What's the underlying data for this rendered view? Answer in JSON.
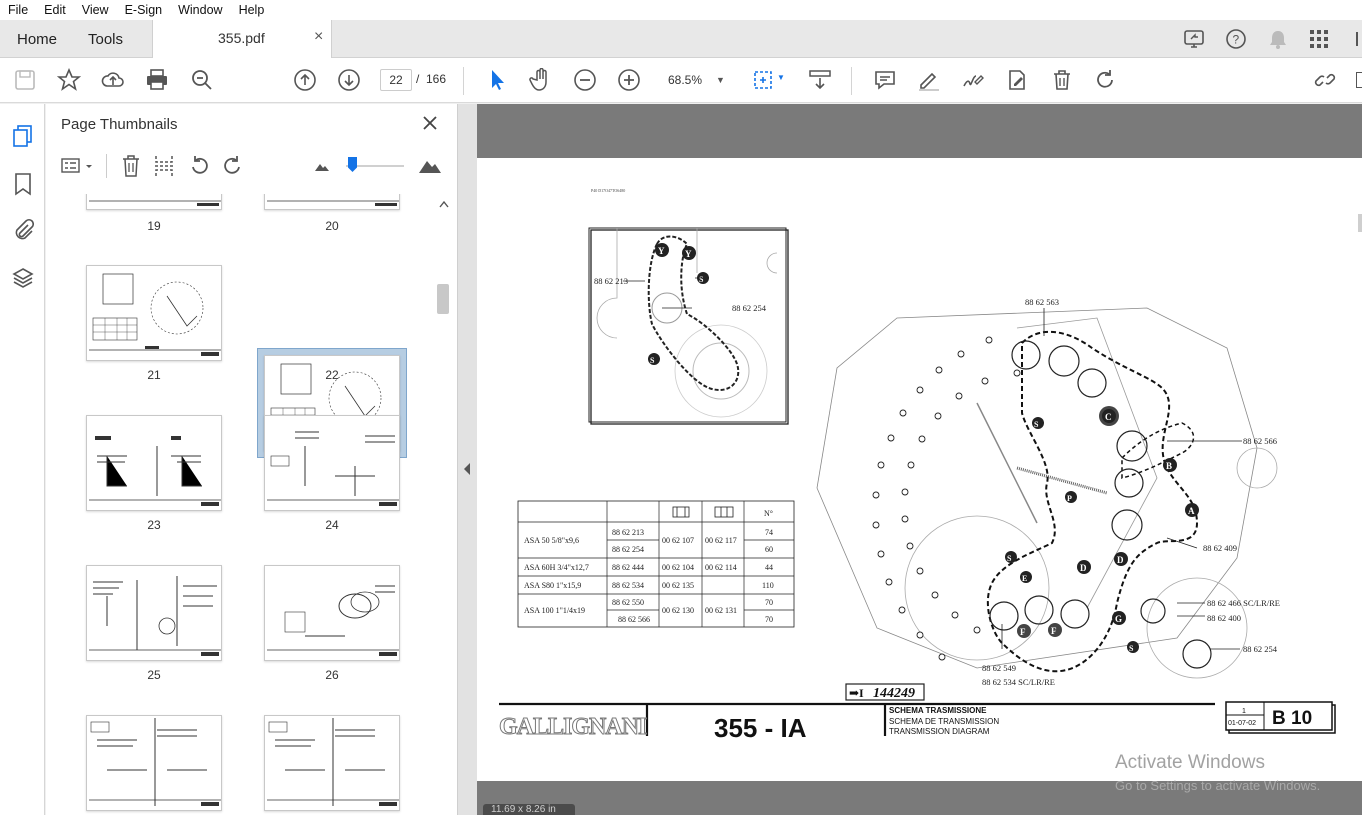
{
  "menu": [
    "File",
    "Edit",
    "View",
    "E-Sign",
    "Window",
    "Help"
  ],
  "tabs": {
    "home": "Home",
    "tools": "Tools",
    "document": "355.pdf",
    "close": "×"
  },
  "toolbar": {
    "page_current": "22",
    "page_separator": "/",
    "page_total": "166",
    "zoom": "68.5%"
  },
  "panel": {
    "title": "Page Thumbnails",
    "selected_page": 22
  },
  "thumbnails": [
    {
      "label": "19"
    },
    {
      "label": "20"
    },
    {
      "label": "21"
    },
    {
      "label": "22"
    },
    {
      "label": "23"
    },
    {
      "label": "24"
    },
    {
      "label": "25"
    },
    {
      "label": "26"
    }
  ],
  "drawing": {
    "brand": "GALLIGNANI",
    "model": "355 - IA",
    "title_lines": [
      "SCHEMA TRASMISSIONE",
      "SCHEMA DE TRANSMISSION",
      "TRANSMISSION DIAGRAM"
    ],
    "sheet_number": "1",
    "sheet_date": "01-07-02",
    "code": "B 10",
    "serial_prefix": "➡I",
    "serial": "144249",
    "small_header": "P40    D17O47TO6480",
    "callouts": {
      "c1": "88 62 213",
      "c2": "88 62 254",
      "c3": "88 62 563",
      "c4": "88 62 566",
      "c5": "88 62 409",
      "c6": "88 62 466 SC/LR/RE",
      "c7": "88 62 400",
      "c8": "88 62 254",
      "c9": "88 62 549",
      "c10": "88 62 534 SC/LR/RE"
    },
    "table": {
      "header_last": "N°",
      "rows": [
        {
          "chain": "ASA 50 5/8\"x9,6",
          "codes": [
            "88 62 213",
            "88 62 254"
          ],
          "a": "00 62 107",
          "b": "00 62 117",
          "n": [
            "74",
            "60"
          ]
        },
        {
          "chain": "ASA 60H 3/4\"x12,7",
          "codes": [
            "88 62 444"
          ],
          "a": "00 62 104",
          "b": "00 62 114",
          "n": [
            "44"
          ]
        },
        {
          "chain": "ASA S80 1\"x15,9",
          "codes": [
            "88 62 534"
          ],
          "a": "00 62 135",
          "b": "",
          "n": [
            "110"
          ]
        },
        {
          "chain": "ASA 100 1\"1/4x19",
          "codes": [
            "88 62 550",
            "88 62 566"
          ],
          "a": "00 62 130",
          "b": "00 62 131",
          "n": [
            "70",
            "70"
          ]
        }
      ]
    }
  },
  "watermark": {
    "line1": "Activate Windows",
    "line2": "Go to Settings to activate Windows."
  },
  "status": "11.69 x 8.26 in"
}
